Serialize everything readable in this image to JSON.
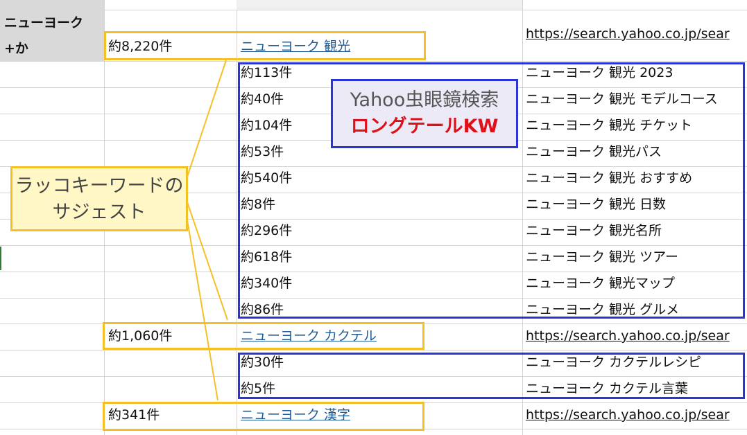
{
  "header": {
    "keyword_line1": "ニューヨーク",
    "keyword_line2": "+か"
  },
  "rows": [
    {
      "count": "約8,220件",
      "keyword": "ニューヨーク 観光",
      "url": "https://search.yahoo.co.jp/sear"
    },
    {
      "count": "約1,060件",
      "keyword": "ニューヨーク カクテル",
      "url": "https://search.yahoo.co.jp/sear"
    },
    {
      "count": "約341件",
      "keyword": "ニューヨーク 漢字",
      "url": "https://search.yahoo.co.jp/sear"
    }
  ],
  "longtail_group1": [
    {
      "count": "約113件",
      "keyword": "ニューヨーク 観光 2023"
    },
    {
      "count": "約40件",
      "keyword": "ニューヨーク 観光 モデルコース"
    },
    {
      "count": "約104件",
      "keyword": "ニューヨーク 観光 チケット"
    },
    {
      "count": "約53件",
      "keyword": "ニューヨーク 観光パス"
    },
    {
      "count": "約540件",
      "keyword": "ニューヨーク 観光 おすすめ"
    },
    {
      "count": "約8件",
      "keyword": "ニューヨーク 観光 日数"
    },
    {
      "count": "約296件",
      "keyword": "ニューヨーク 観光名所"
    },
    {
      "count": "約618件",
      "keyword": "ニューヨーク 観光 ツアー"
    },
    {
      "count": "約340件",
      "keyword": "ニューヨーク 観光マップ"
    },
    {
      "count": "約86件",
      "keyword": "ニューヨーク 観光 グルメ"
    }
  ],
  "longtail_group2": [
    {
      "count": "約30件",
      "keyword": "ニューヨーク カクテルレシピ"
    },
    {
      "count": "約5件",
      "keyword": "ニューヨーク カクテル言葉"
    }
  ],
  "callouts": {
    "suggest_line1": "ラッコキーワードの",
    "suggest_line2": "サジェスト",
    "yahoo_line1": "Yahoo虫眼鏡検索",
    "yahoo_line2": "ロングテールKW"
  },
  "colors": {
    "highlight_yellow": "#f5c024",
    "highlight_blue": "#2b35d6",
    "accent_red": "#e0101a",
    "link_blue": "#1f5c99"
  }
}
